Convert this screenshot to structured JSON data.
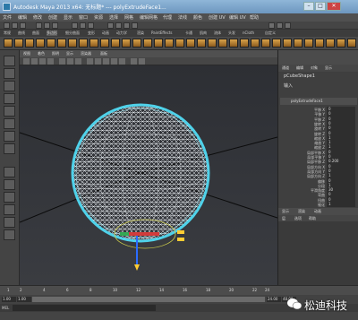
{
  "window": {
    "title": "Autodesk Maya 2013 x64: 无标题*    ---    polyExtrudeFace1...",
    "min_label": "–",
    "max_label": "□",
    "close_label": "✕"
  },
  "menubar": {
    "items": [
      "文件",
      "编辑",
      "修改",
      "创建",
      "显示",
      "窗口",
      "资源",
      "选择",
      "网格",
      "编辑网格",
      "代理",
      "法线",
      "颜色",
      "创建 UV",
      "编辑 UV",
      "帮助"
    ]
  },
  "shelf_tabs": {
    "items": [
      "常规",
      "曲线",
      "曲面",
      "多边形",
      "细分曲面",
      "变形",
      "动画",
      "动力学",
      "渲染",
      "PaintEffects",
      "卡通",
      "肌肉",
      "流体",
      "头发",
      "nCloth",
      "自定义"
    ]
  },
  "viewport": {
    "menu": [
      "视图",
      "着色",
      "照明",
      "显示",
      "渲染器",
      "面板"
    ]
  },
  "channel_box": {
    "menu": [
      "通道",
      "编辑",
      "对象",
      "显示"
    ],
    "object_name": "pCubeShape1",
    "inputs_label": "输入",
    "node_name": "polyExtrudeFace1",
    "attributes": [
      {
        "label": "平移 X",
        "value": "0"
      },
      {
        "label": "平移 Y",
        "value": "0"
      },
      {
        "label": "平移 Z",
        "value": "0"
      },
      {
        "label": "旋转 X",
        "value": "0"
      },
      {
        "label": "旋转 Y",
        "value": "0"
      },
      {
        "label": "旋转 Z",
        "value": "0"
      },
      {
        "label": "缩放 X",
        "value": "1"
      },
      {
        "label": "缩放 Y",
        "value": "1"
      },
      {
        "label": "缩放 Z",
        "value": "1"
      },
      {
        "label": "局部平移 X",
        "value": "0"
      },
      {
        "label": "局部平移 Y",
        "value": "0"
      },
      {
        "label": "局部平移 Z",
        "value": "0.200"
      },
      {
        "label": "局部方向 X",
        "value": "0"
      },
      {
        "label": "局部方向 Y",
        "value": "0"
      },
      {
        "label": "局部方向 Z",
        "value": "1"
      },
      {
        "label": "偏移",
        "value": "0"
      },
      {
        "label": "分段",
        "value": "1"
      },
      {
        "label": "平滑角度",
        "value": "30"
      },
      {
        "label": "弯曲",
        "value": "0"
      },
      {
        "label": "扭曲",
        "value": "0"
      },
      {
        "label": "锥化",
        "value": "1"
      }
    ]
  },
  "layers": {
    "tabs": [
      "显示",
      "渲染",
      "动画"
    ],
    "menu": [
      "层",
      "选项",
      "帮助"
    ]
  },
  "timeline": {
    "ticks": [
      "1",
      "2",
      "4",
      "6",
      "8",
      "10",
      "12",
      "14",
      "16",
      "18",
      "20",
      "22",
      "24"
    ]
  },
  "range": {
    "start": "1.00",
    "start2": "1.00",
    "end": "24.00",
    "end2": "48.00"
  },
  "cmdline": {
    "mel_label": "MEL"
  },
  "watermark": {
    "text": "松迪科技"
  },
  "colors": {
    "wireframe": "#e9eef2",
    "selection": "#4fd2ea",
    "grid": "#0b0b0b"
  }
}
